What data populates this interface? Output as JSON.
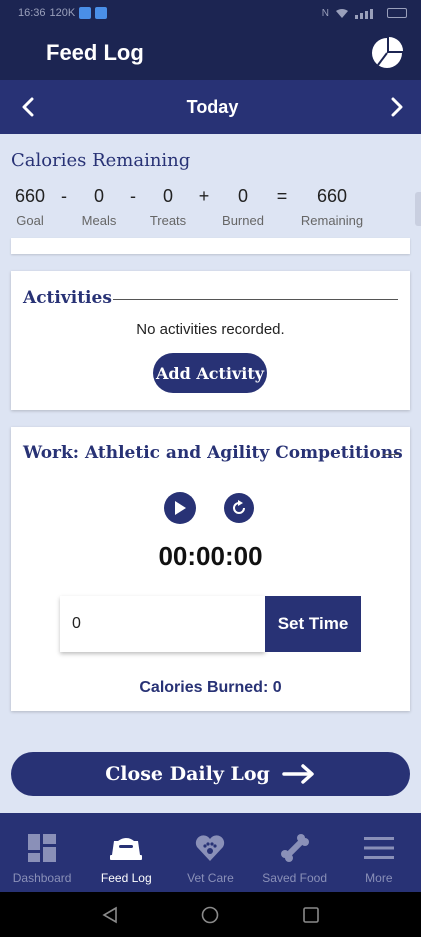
{
  "status": {
    "time": "16:36",
    "speed": "120K"
  },
  "header": {
    "title": "Feed Log",
    "stats_icon": "pie-chart-icon"
  },
  "date_nav": {
    "label": "Today"
  },
  "calories": {
    "title": "Calories Remaining",
    "goal": {
      "value": "660",
      "label": "Goal"
    },
    "op1": "-",
    "meals": {
      "value": "0",
      "label": "Meals"
    },
    "op2": "-",
    "treats": {
      "value": "0",
      "label": "Treats"
    },
    "op3": "+",
    "burned": {
      "value": "0",
      "label": "Burned"
    },
    "op4": "=",
    "remaining": {
      "value": "660",
      "label": "Remaining"
    }
  },
  "activities": {
    "title": "Activities",
    "empty_message": "No activities recorded.",
    "add_label": "Add Activity"
  },
  "work": {
    "title": "Work: Athletic and Agility Competitions",
    "timer": "00:00:00",
    "time_value": "0",
    "set_time_label": "Set Time",
    "burned_text": "Calories Burned: 0"
  },
  "close_label": "Close Daily Log",
  "tabs": [
    {
      "label": "Dashboard",
      "icon": "dashboard-icon"
    },
    {
      "label": "Feed Log",
      "icon": "food-bowl-icon",
      "active": true
    },
    {
      "label": "Vet Care",
      "icon": "heart-paw-icon"
    },
    {
      "label": "Saved Food",
      "icon": "bone-icon"
    },
    {
      "label": "More",
      "icon": "menu-icon"
    }
  ],
  "colors": {
    "primary": "#283275",
    "header": "#1c2552",
    "background": "#dde4f3",
    "inactive_tab": "#8a90b8"
  }
}
